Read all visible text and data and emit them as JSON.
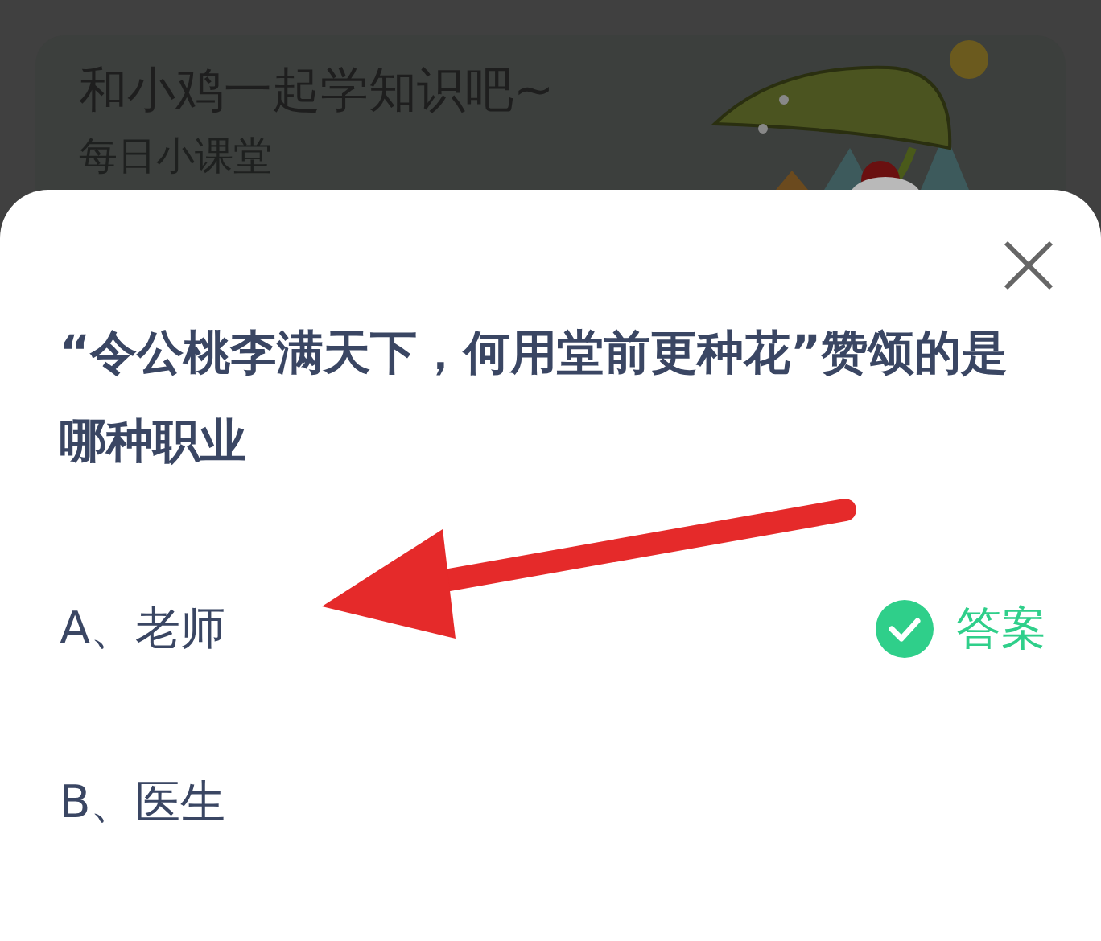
{
  "banner": {
    "title": "和小鸡一起学知识吧~",
    "subtitle": "每日小课堂"
  },
  "dialog": {
    "question": "“令公桃李满天下，何用堂前更种花”赞颂的是哪种职业",
    "options": [
      {
        "label": "A、老师",
        "correct": true
      },
      {
        "label": "B、医生",
        "correct": false
      }
    ],
    "answer_label": "答案"
  }
}
